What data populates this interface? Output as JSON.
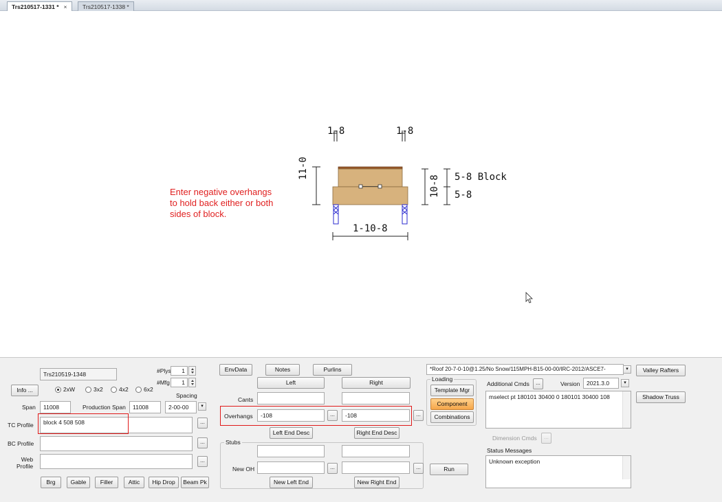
{
  "tabs": [
    {
      "label": "Trs210517-1331 *",
      "close": "×"
    },
    {
      "label": "Trs210517-1338 *"
    }
  ],
  "canvas": {
    "note": "Enter negative overhangs\nto hold back either or both\nsides of block.",
    "dims": {
      "top_left": "1-8",
      "top_right": "1-8",
      "left_height": "11-0",
      "right_height": "10-8",
      "right_upper": "5-8 Block",
      "right_lower": "5-8",
      "bottom_span": "1-10-8"
    }
  },
  "panel": {
    "truss_name": "Trs210519-1348",
    "plys_label": "#Plys",
    "plys_value": "1",
    "mfg_label": "#Mfg",
    "mfg_value": "1",
    "info_button": "Info ...",
    "radios": [
      {
        "label": "2xW",
        "checked": true
      },
      {
        "label": "3x2",
        "checked": false
      },
      {
        "label": "4x2",
        "checked": false
      },
      {
        "label": "6x2",
        "checked": false
      }
    ],
    "spacing_label": "Spacing",
    "span_label": "Span",
    "span_value": "11008",
    "production_span_label": "Production Span",
    "production_span_value": "11008",
    "spacing_value": "2-00-00",
    "tc_profile_label": "TC Profile",
    "tc_profile_value": "block 4 508 508",
    "bc_profile_label": "BC Profile",
    "bc_profile_value": "",
    "web_profile_label": "Web\nProfile",
    "web_profile_value": "",
    "bottom_buttons": [
      "Brg",
      "Gable",
      "Filler",
      "Attic",
      "Hip Drop",
      "Beam Pk"
    ],
    "envdata_button": "EnvData",
    "notes_button": "Notes",
    "purlins_button": "Purlins",
    "left_button": "Left",
    "right_button": "Right",
    "cants_label": "Cants",
    "cants_left": "",
    "cants_right": "",
    "overhangs_label": "Overhangs",
    "overhang_left": "-108",
    "overhang_right": "-108",
    "left_end_desc": "Left End Desc",
    "right_end_desc": "Right End Desc",
    "stubs_label": "Stubs",
    "stubs_left": "",
    "stubs_right": "",
    "new_oh_label": "New OH",
    "new_oh_left": "",
    "new_oh_right": "",
    "new_left_end": "New Left End",
    "new_right_end": "New Right End",
    "run_button": "Run",
    "loading_dropdown": "*Roof 20-7-0-10@1.25/No Snow/115MPH-B15-00-00/IRC-2012/ASCE7-",
    "loading_label": "Loading",
    "template_mgr_button": "Template Mgr",
    "component_button": "Component",
    "combinations_button": "Combinations",
    "additional_cmds_label": "Additional Cmds",
    "version_label": "Version",
    "version_value": "2021.3.0",
    "additional_cmds_text": "mselect pt 180101 30400 0  180101 30400 108",
    "dimension_cmds_label": "Dimension Cmds",
    "status_messages_label": "Status Messages",
    "status_messages_text": "Unknown exception",
    "valley_rafters_button": "Valley Rafters",
    "shadow_truss_button": "Shadow Truss",
    "ellipsis": "...",
    "dropdown_arrow": "▾"
  },
  "colors": {
    "note_red": "#e02020",
    "highlight_red": "#e01818",
    "lumber": "#d7b27d",
    "lumber_edge": "#8a6a3e",
    "bearing": "#2a2acf",
    "component_orange": "#f6a64a"
  }
}
